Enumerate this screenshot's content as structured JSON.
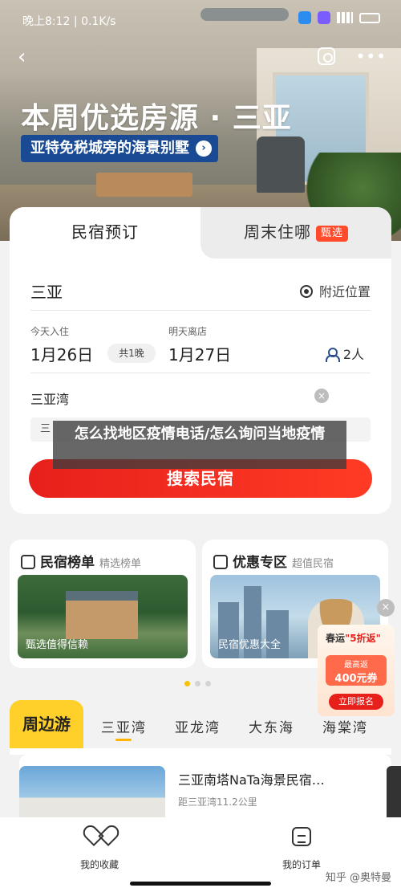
{
  "status": {
    "time": "晚上8:12",
    "speed": "0.1K/s"
  },
  "hero": {
    "title": "本周优选房源 · 三亚",
    "subtitle": "亚特免税城旁的海景别墅"
  },
  "booking": {
    "tabs": [
      {
        "label": "民宿预订"
      },
      {
        "label": "周末住哪",
        "badge": "甄选"
      }
    ],
    "city": "三亚",
    "nearby": "附近位置",
    "checkin_label": "今天入住",
    "checkin": "1月26日",
    "nights": "共1晚",
    "checkout_label": "明天离店",
    "checkout": "1月27日",
    "guests": "2人",
    "keyword": "三亚湾",
    "filter": "三",
    "search": "搜索民宿"
  },
  "overlay_title": "怎么找地区疫情电话/怎么询问当地疫情",
  "promos": [
    {
      "title": "民宿榜单",
      "sub": "精选榜单",
      "caption": "甄选值得信赖"
    },
    {
      "title": "优惠专区",
      "sub": "超值民宿",
      "caption": "民宿优惠大全"
    }
  ],
  "ad": {
    "line1a": "春运",
    "line1b": "\"5折返\"",
    "coupon_top": "最高返",
    "coupon_val": "400元券",
    "btn": "立即报名"
  },
  "nearby_section": {
    "main": "周边游",
    "tabs": [
      "三亚湾",
      "亚龙湾",
      "大东海",
      "海棠湾"
    ]
  },
  "listing": {
    "name": "三亚南塔NaTa海景民宿…",
    "dist": "距三亚湾11.2公里"
  },
  "bottom": {
    "fav": "我的收藏",
    "orders": "我的订单"
  },
  "watermark": "知乎 @奥特曼",
  "colors": {
    "primary_red": "#e8201c",
    "yellow": "#ffd02a",
    "navy": "#1a4a93"
  }
}
